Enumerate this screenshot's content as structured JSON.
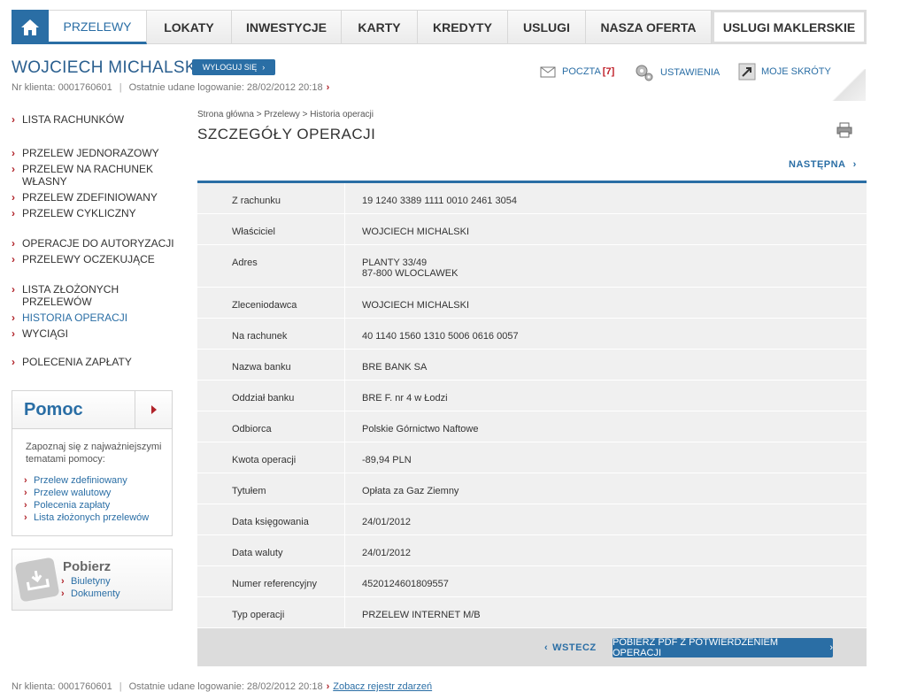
{
  "nav": {
    "tabs": [
      {
        "label": "PRZELEWY"
      },
      {
        "label": "LOKATY"
      },
      {
        "label": "INWESTYCJE"
      },
      {
        "label": "KARTY"
      },
      {
        "label": "KREDYTY"
      },
      {
        "label": "USLUGI"
      },
      {
        "label": "NASZA OFERTA"
      },
      {
        "label": "USLUGI MAKLERSKIE"
      }
    ]
  },
  "user": {
    "name": "WOJCIECH MICHALSKI",
    "logout_label": "WYLOGUJ SIĘ",
    "client_no": "Nr klienta: 0001760601",
    "last_login": "Ostatnie udane logowanie: 28/02/2012 20:18"
  },
  "tools": {
    "poczta_label": "POCZTA",
    "poczta_count": "[7]",
    "ustawienia_label": "USTAWIENIA",
    "skroty_label": "MOJE SKRÓTY"
  },
  "sidebar": {
    "items": [
      {
        "label": "LISTA RACHUNKÓW"
      },
      {
        "label": "PRZELEW JEDNORAZOWY"
      },
      {
        "label": "PRZELEW NA RACHUNEK WŁASNY"
      },
      {
        "label": "PRZELEW ZDEFINIOWANY"
      },
      {
        "label": "PRZELEW CYKLICZNY"
      },
      {
        "label": "OPERACJE DO AUTORYZACJI"
      },
      {
        "label": "PRZELEWY OCZEKUJĄCE"
      },
      {
        "label": "LISTA ZŁOŻONYCH PRZELEWÓW"
      },
      {
        "label": "HISTORIA OPERACJI"
      },
      {
        "label": "WYCIĄGI"
      },
      {
        "label": "POLECENIA ZAPŁATY"
      }
    ]
  },
  "help": {
    "title": "Pomoc",
    "text": "Zapoznaj się z najważniejszymi tematami pomocy:",
    "links": [
      {
        "label": "Przelew zdefiniowany"
      },
      {
        "label": "Przelew walutowy"
      },
      {
        "label": "Polecenia zapłaty"
      },
      {
        "label": "Lista złożonych przelewów"
      }
    ]
  },
  "downloads": {
    "title": "Pobierz",
    "links": [
      {
        "label": "Biuletyny"
      },
      {
        "label": "Dokumenty"
      }
    ]
  },
  "page": {
    "breadcrumb": "Strona główna > Przelewy > Historia operacji",
    "title": "SZCZEGÓŁY OPERACJI",
    "next_label": "NASTĘPNA"
  },
  "details": [
    {
      "label": "Z rachunku",
      "value": "19 1240 3389 1111 0010 2461 3054"
    },
    {
      "label": "Właściciel",
      "value": "WOJCIECH MICHALSKI"
    },
    {
      "label": "Adres",
      "value": "PLANTY 33/49",
      "value2": "87-800 WLOCLAWEK"
    },
    {
      "label": "Zleceniodawca",
      "value": "WOJCIECH MICHALSKI"
    },
    {
      "label": "Na rachunek",
      "value": "40 1140 1560 1310 5006 0616 0057"
    },
    {
      "label": "Nazwa banku",
      "value": "BRE BANK SA"
    },
    {
      "label": "Oddział banku",
      "value": "BRE F. nr 4 w Łodzi"
    },
    {
      "label": "Odbiorca",
      "value": "Polskie Górnictwo Naftowe"
    },
    {
      "label": "Kwota operacji",
      "value": "-89,94 PLN"
    },
    {
      "label": "Tytułem",
      "value": "Opłata za Gaz Ziemny"
    },
    {
      "label": "Data księgowania",
      "value": "24/01/2012"
    },
    {
      "label": "Data waluty",
      "value": "24/01/2012"
    },
    {
      "label": "Numer referencyjny",
      "value": "4520124601809557"
    },
    {
      "label": "Typ operacji",
      "value": "PRZELEW INTERNET M/B"
    }
  ],
  "footer": {
    "back_label": "WSTECZ",
    "pdf_label": "POBIERZ PDF Z POTWIERDZENIEM OPERACJI",
    "client_no": "Nr klienta: 0001760601",
    "last_login": "Ostatnie udane logowanie: 28/02/2012 20:18",
    "events_link": "Zobacz rejestr zdarzeń"
  }
}
